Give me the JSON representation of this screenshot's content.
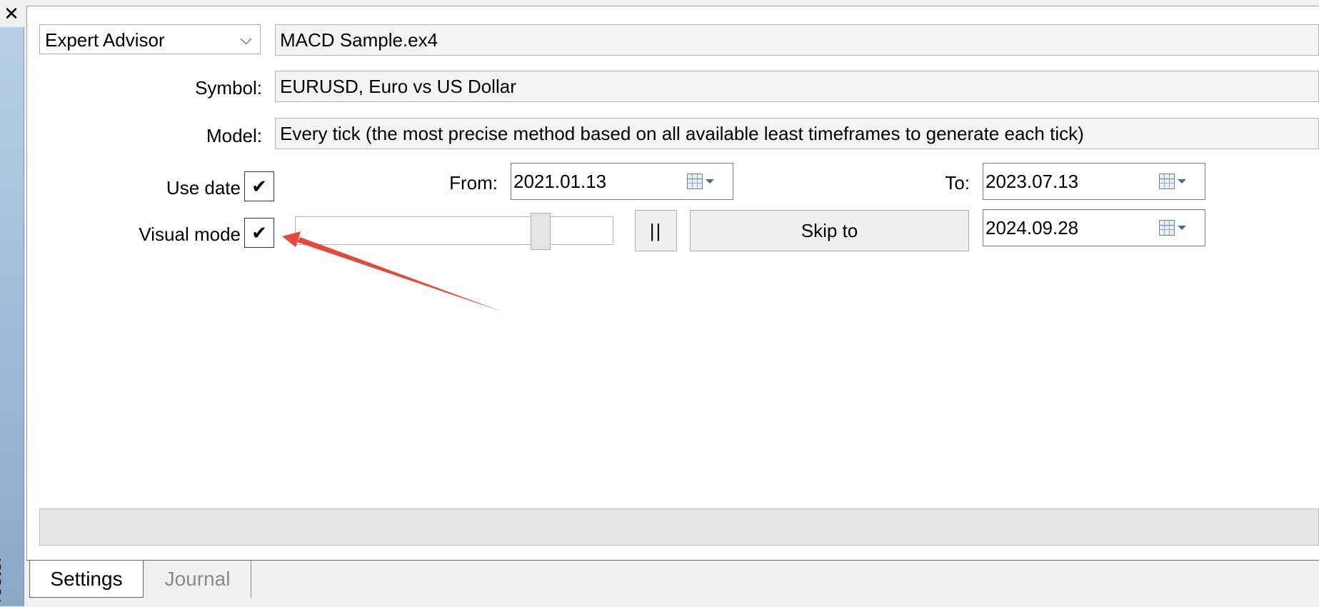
{
  "window": {
    "close_glyph": "✕",
    "side_label": "Tester"
  },
  "settings": {
    "type_combo": {
      "value": "Expert Advisor"
    },
    "expert_file": "MACD Sample.ex4",
    "symbol_label": "Symbol:",
    "symbol_value": "EURUSD, Euro vs US Dollar",
    "model_label": "Model:",
    "model_value": "Every tick (the most precise method based on all available least timeframes to generate each tick)",
    "use_date_label": "Use date",
    "use_date_checked": true,
    "from_label": "From:",
    "from_value": "2021.01.13",
    "to_label": "To:",
    "to_value": "2023.07.13",
    "visual_mode_label": "Visual mode",
    "visual_mode_checked": true,
    "check_glyph": "✔",
    "speed_slider_fraction": 0.79,
    "pause_label": "||",
    "skip_to_label": "Skip to",
    "skip_to_date": "2024.09.28"
  },
  "tabs": [
    {
      "label": "Settings",
      "active": true
    },
    {
      "label": "Journal",
      "active": false
    }
  ],
  "annotation": {
    "arrow_color": "#e34a3a"
  },
  "icons": [
    "close-icon",
    "chevron-down-icon",
    "calendar-icon",
    "dropdown-arrow-icon",
    "checkmark-icon"
  ]
}
